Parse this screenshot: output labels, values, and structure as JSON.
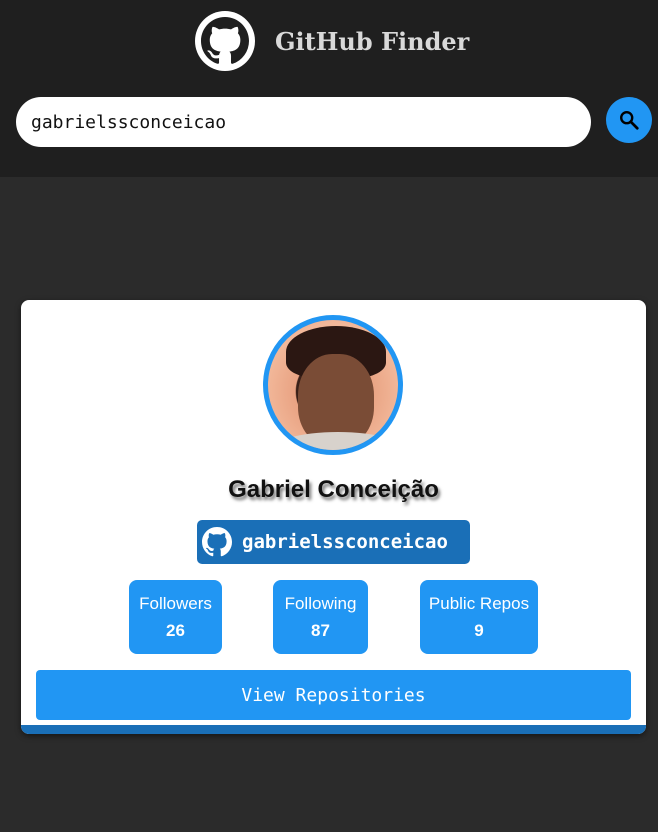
{
  "header": {
    "logo_icon": "github-icon",
    "title": "GitHub Finder"
  },
  "search": {
    "value": "gabrielssconceicao",
    "button_icon": "search-icon"
  },
  "profile": {
    "name": "Gabriel Conceição",
    "username": "gabrielssconceicao",
    "username_icon": "github-icon",
    "avatar_alt": "avatar",
    "stats": [
      {
        "label": "Followers",
        "value": "26"
      },
      {
        "label": "Following",
        "value": "87"
      },
      {
        "label": "Public Repos",
        "value": "9"
      }
    ],
    "view_button_label": "View Repositories"
  },
  "colors": {
    "accent": "#2196f3",
    "badge": "#1a6fb7",
    "header_bg": "#1f1f1f",
    "page_bg": "#2b2b2b"
  }
}
